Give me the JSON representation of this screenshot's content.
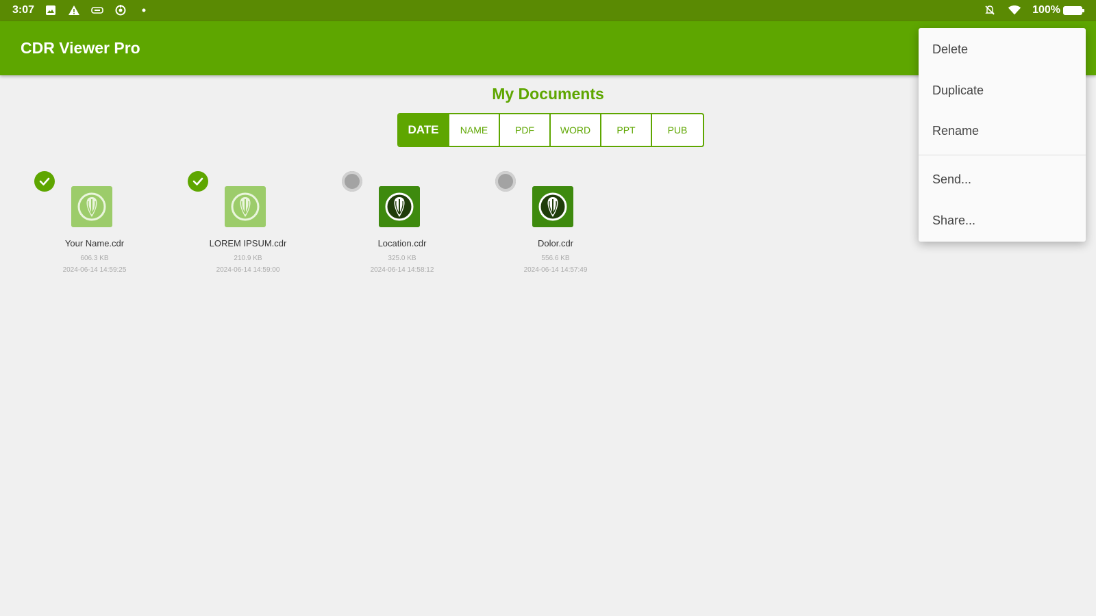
{
  "status_bar": {
    "time": "3:07",
    "left_icons": [
      "image-icon",
      "warning-icon",
      "shield-icon",
      "sync-icon",
      "dot-icon"
    ],
    "right_icons": [
      "notifications-off-icon",
      "wifi-icon",
      "battery-icon"
    ],
    "battery": "100%"
  },
  "app_bar": {
    "title": "CDR Viewer Pro"
  },
  "main": {
    "heading": "My Documents",
    "tabs": [
      {
        "label": "DATE",
        "active": true
      },
      {
        "label": "NAME",
        "active": false
      },
      {
        "label": "PDF",
        "active": false
      },
      {
        "label": "WORD",
        "active": false
      },
      {
        "label": "PPT",
        "active": false
      },
      {
        "label": "PUB",
        "active": false
      }
    ],
    "documents": [
      {
        "name": "Your Name.cdr",
        "size": "606.3 KB",
        "date": "2024-06-14 14:59:25",
        "selected": true
      },
      {
        "name": "LOREM IPSUM.cdr",
        "size": "210.9 KB",
        "date": "2024-06-14 14:59:00",
        "selected": true
      },
      {
        "name": "Location.cdr",
        "size": "325.0 KB",
        "date": "2024-06-14 14:58:12",
        "selected": false
      },
      {
        "name": "Dolor.cdr",
        "size": "556.6 KB",
        "date": "2024-06-14 14:57:49",
        "selected": false
      }
    ]
  },
  "context_menu": {
    "items": [
      "Delete",
      "Duplicate",
      "Rename",
      "Send...",
      "Share..."
    ]
  },
  "colors": {
    "status_bar": "#5a8a03",
    "app_bar": "#5ea600",
    "accent": "#5ea600",
    "icon_light": "#9ccc6a",
    "icon_dark": "#3e8a0e"
  }
}
